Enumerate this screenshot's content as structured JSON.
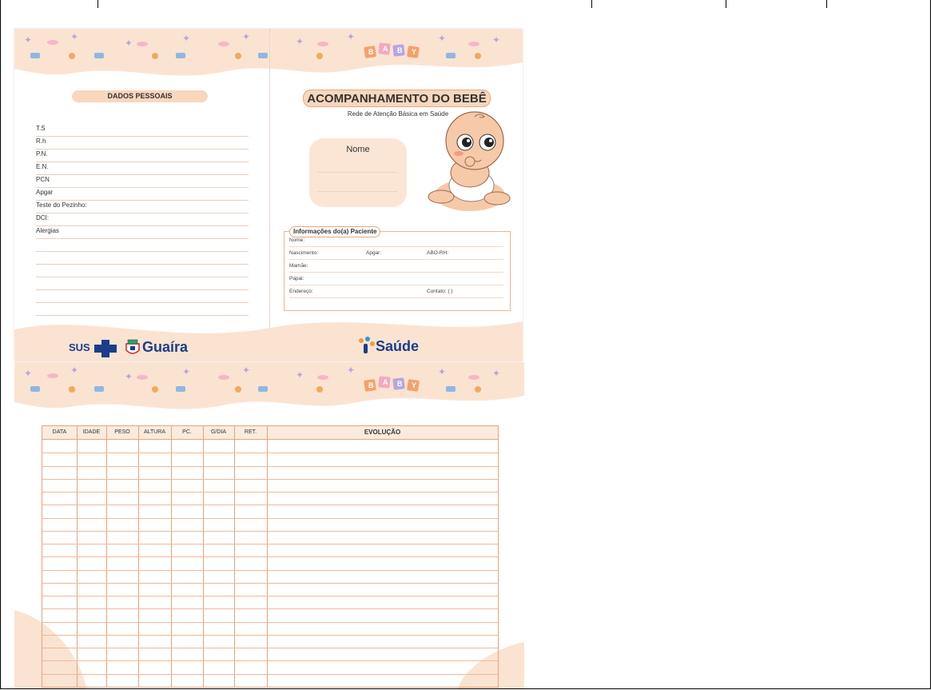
{
  "left_page": {
    "section_title": "DADOS PESSOAIS",
    "fields": [
      "T.S",
      "R.h",
      "P.N.",
      "E.N.",
      "PCN",
      "Apgar",
      "Teste do Pezinho:",
      "DCI:",
      "Alergias"
    ],
    "blank_lines": 6
  },
  "right_page": {
    "title": "ACOMPANHAMENTO DO BEBÊ",
    "subtitle": "Rede de Atenção Básica em Saúde",
    "name_label": "Nome",
    "info": {
      "legend": "Informações do(a) Paciente",
      "nome": "Nome:",
      "nascimento": "Nascimento:",
      "apgar": "Apgar:",
      "abo": "ABO-RH:",
      "mamae": "Mamãe:",
      "papai": "Papai:",
      "endereco": "Endereço:",
      "contato": "Contato: (    )"
    },
    "baby_blocks": [
      "B",
      "A",
      "B",
      "Y"
    ]
  },
  "logos": {
    "sus": "SUS",
    "guaira": "Guaíra",
    "saude": "Saúde"
  },
  "table": {
    "headers": [
      "DATA",
      "IDADE",
      "PESO",
      "ALTURA",
      "PC.",
      "G/DIA",
      "RET.",
      "EVOLUÇÃO"
    ],
    "row_count": 19
  },
  "colors": {
    "peach": "#f8d7bd",
    "line": "#e7a37e",
    "navy": "#1a3e8a"
  }
}
